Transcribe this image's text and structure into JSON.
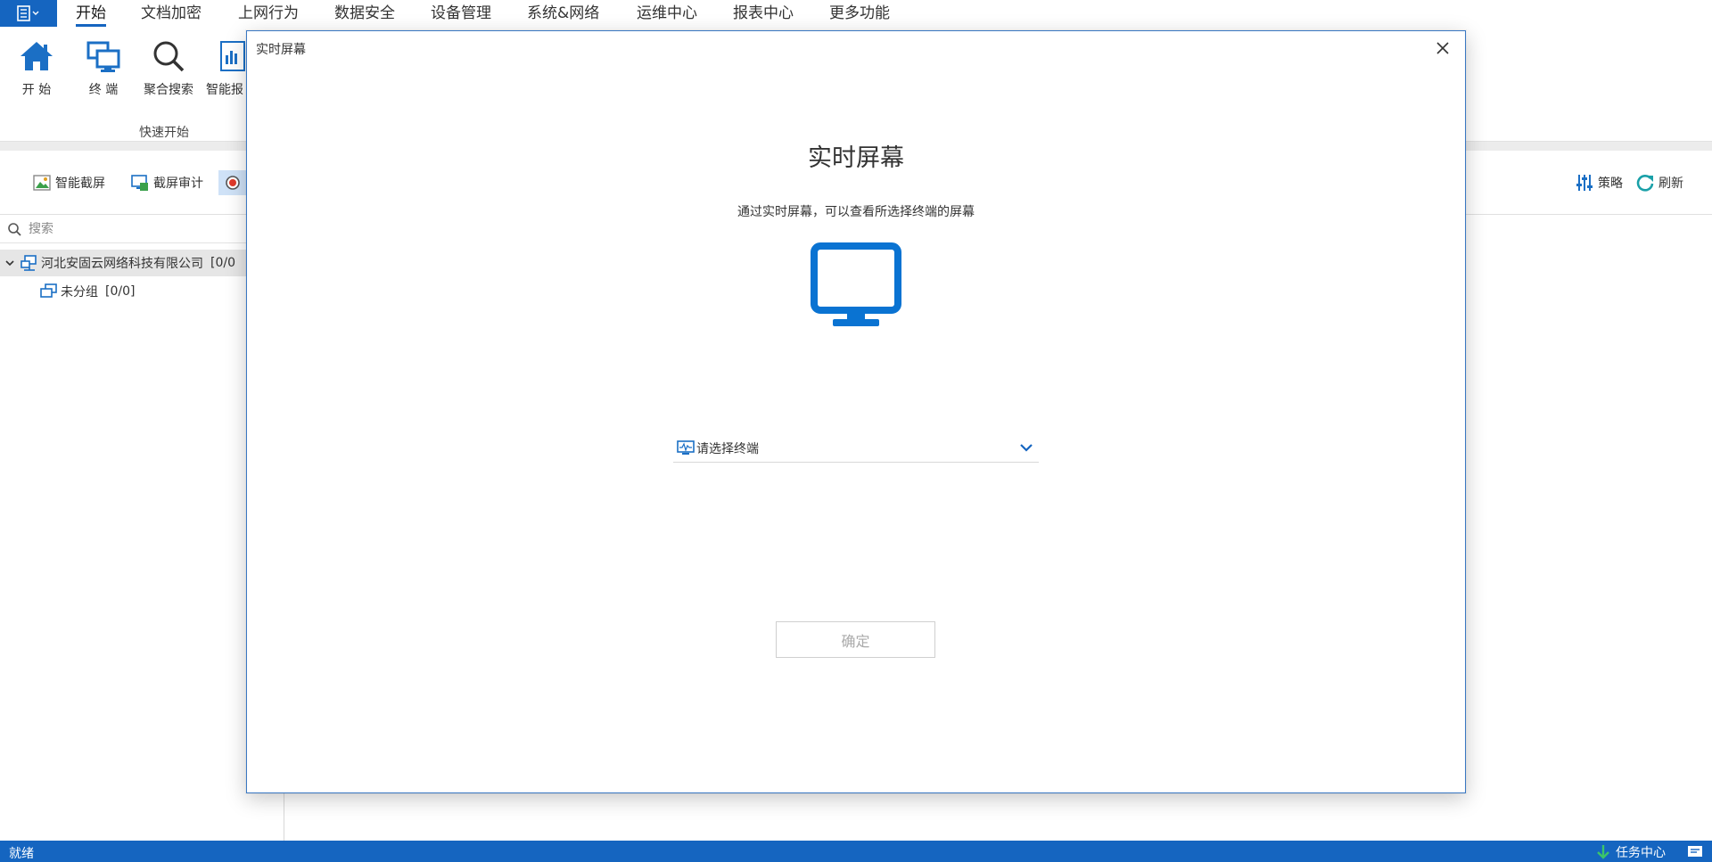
{
  "menubar": {
    "items": [
      "开始",
      "文档加密",
      "上网行为",
      "数据安全",
      "设备管理",
      "系统&网络",
      "运维中心",
      "报表中心",
      "更多功能"
    ],
    "active": "开始"
  },
  "ribbon": {
    "buttons": [
      {
        "label": "开 始",
        "icon": "home-icon"
      },
      {
        "label": "终 端",
        "icon": "terminal-icon"
      },
      {
        "label": "聚合搜索",
        "icon": "search-icon"
      },
      {
        "label": "智能报",
        "icon": "report-icon"
      }
    ],
    "group_label": "快速开始"
  },
  "toolbar": {
    "smart_screenshot": "智能截屏",
    "screenshot_audit": "截屏审计",
    "policy": "策略",
    "refresh": "刷新"
  },
  "leftpanel": {
    "search_placeholder": "搜索",
    "tree": [
      {
        "label": "河北安固云网络科技有限公司",
        "count": "[0/0"
      },
      {
        "label": "未分组",
        "count": "[0/0]"
      }
    ]
  },
  "statusbar": {
    "status": "就绪",
    "task_center": "任务中心"
  },
  "modal": {
    "title": "实时屏幕",
    "heading": "实时屏幕",
    "description": "通过实时屏幕，可以查看所选择终端的屏幕",
    "select_placeholder": "请选择终端",
    "confirm": "确定"
  },
  "colors": {
    "accent": "#1565c0",
    "icon_blue": "#0a73d2",
    "modal_border": "#3a78c3"
  }
}
